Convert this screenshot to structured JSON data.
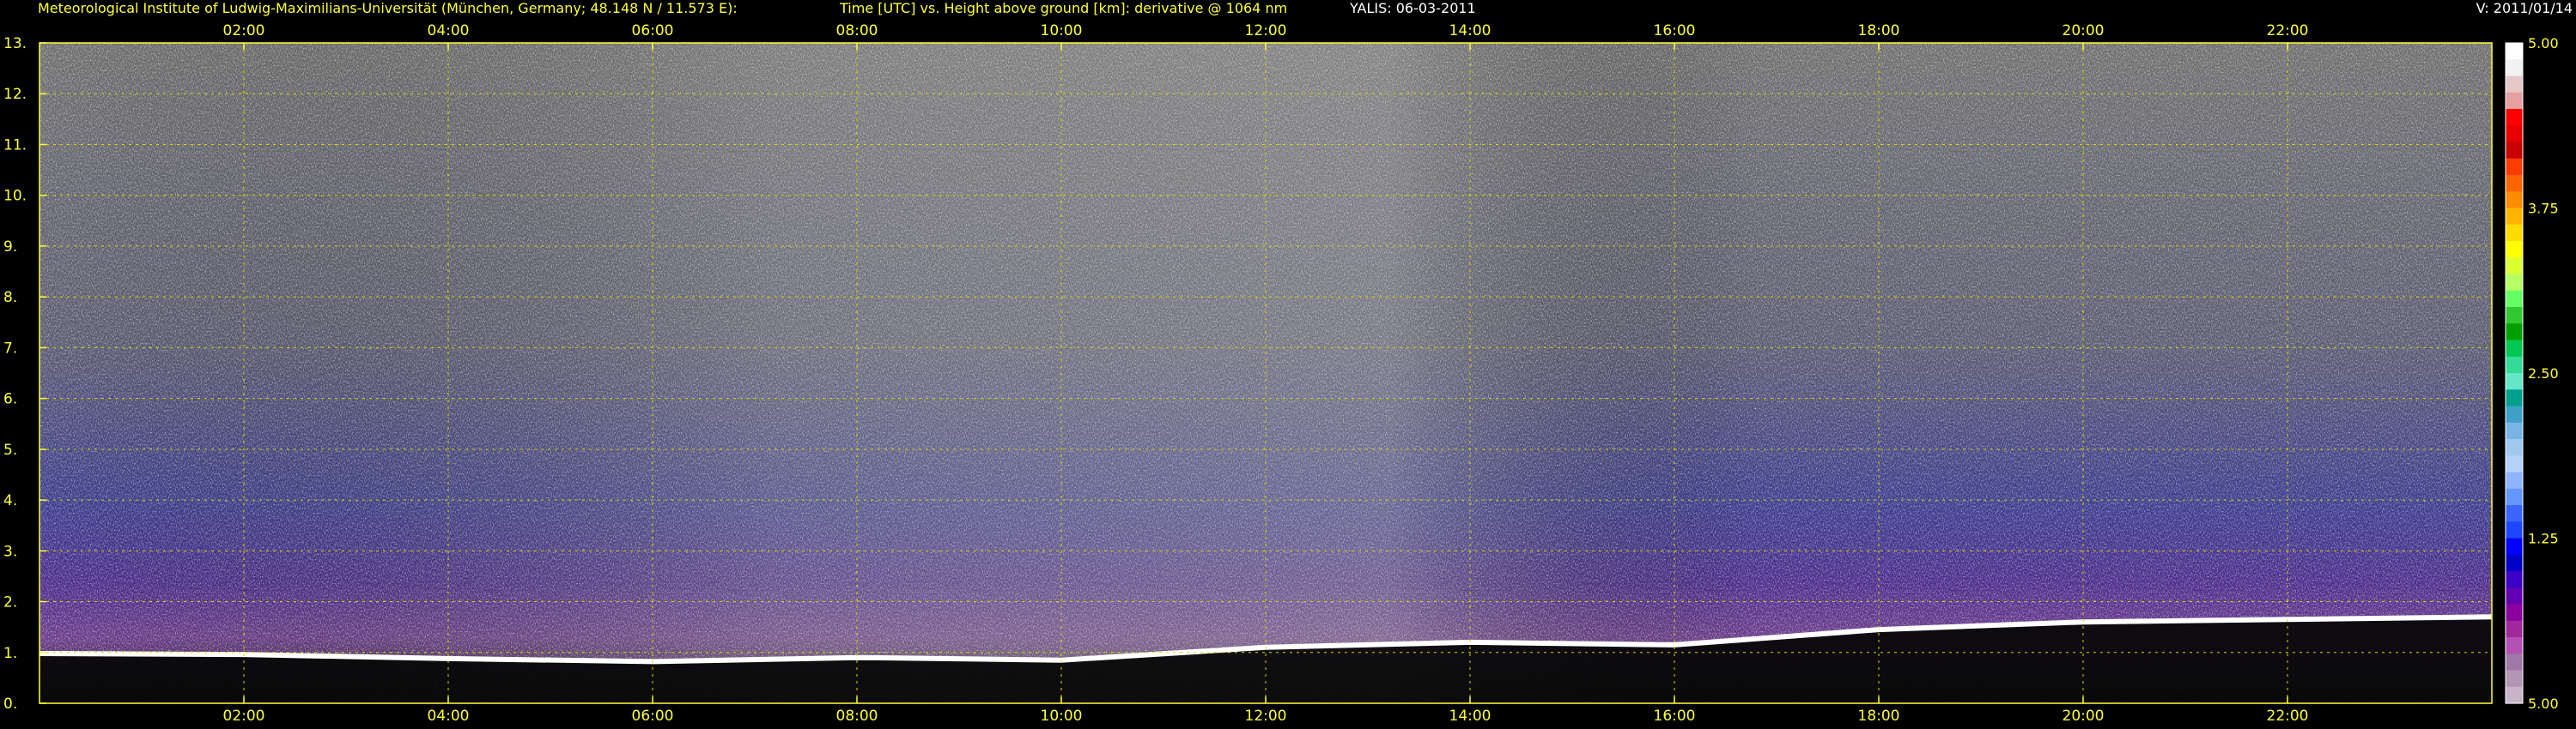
{
  "header": {
    "institute": "Meteorological Institute of Ludwig-Maximilians-Universität (München, Germany; 48.148 N / 11.573 E):",
    "title": "Time [UTC] vs. Height above ground [km]: derivative @ 1064 nm",
    "instrument_date": "YALIS: 06-03-2011",
    "version": "V: 2011/01/14"
  },
  "colors": {
    "text_yellow": "#ffff33",
    "text_white": "#ffffff",
    "grid": "#d8d800",
    "background": "#000000"
  },
  "chart_data": {
    "type": "heatmap",
    "title": "Time [UTC] vs. Height above ground [km]: derivative @ 1064 nm",
    "xlabel": "Time [UTC]",
    "ylabel": "Height above ground [km]",
    "x_range_hours": [
      0,
      24
    ],
    "x_ticks": [
      {
        "hour": 2,
        "label": "02:00"
      },
      {
        "hour": 4,
        "label": "04:00"
      },
      {
        "hour": 6,
        "label": "06:00"
      },
      {
        "hour": 8,
        "label": "08:00"
      },
      {
        "hour": 10,
        "label": "10:00"
      },
      {
        "hour": 12,
        "label": "12:00"
      },
      {
        "hour": 14,
        "label": "14:00"
      },
      {
        "hour": 16,
        "label": "16:00"
      },
      {
        "hour": 18,
        "label": "18:00"
      },
      {
        "hour": 20,
        "label": "20:00"
      },
      {
        "hour": 22,
        "label": "22:00"
      }
    ],
    "ylim": [
      0,
      13
    ],
    "y_ticks": [
      {
        "value": 0,
        "label": "0."
      },
      {
        "value": 1,
        "label": "1."
      },
      {
        "value": 2,
        "label": "2."
      },
      {
        "value": 3,
        "label": "3."
      },
      {
        "value": 4,
        "label": "4."
      },
      {
        "value": 5,
        "label": "5."
      },
      {
        "value": 6,
        "label": "6."
      },
      {
        "value": 7,
        "label": "7."
      },
      {
        "value": 8,
        "label": "8."
      },
      {
        "value": 9,
        "label": "9."
      },
      {
        "value": 10,
        "label": "10."
      },
      {
        "value": 11,
        "label": "11."
      },
      {
        "value": 12,
        "label": "12."
      },
      {
        "value": 13,
        "label": "13."
      }
    ],
    "grid": true,
    "colorbar": {
      "labels": [
        {
          "value": 5.0,
          "label": "5.00"
        },
        {
          "value": 3.75,
          "label": "3.75"
        },
        {
          "value": 2.5,
          "label": "2.50"
        },
        {
          "value": 1.25,
          "label": "1.25"
        },
        {
          "value": 0,
          "label": "5.00"
        }
      ],
      "colors_top_to_bottom": [
        "#ffffff",
        "#f2f2f2",
        "#e6c8c8",
        "#e6a0a0",
        "#ff0000",
        "#e60000",
        "#c80000",
        "#ff3c00",
        "#ff6400",
        "#ff8c00",
        "#ffb400",
        "#ffdc00",
        "#ffff00",
        "#dcff32",
        "#b4ff64",
        "#64ff64",
        "#32c832",
        "#00a000",
        "#00c850",
        "#32dc96",
        "#64e6c8",
        "#00a08c",
        "#3ca0c8",
        "#78b4e6",
        "#a0c8f0",
        "#b4d2fa",
        "#8cb4ff",
        "#6496ff",
        "#3c64ff",
        "#1e46ff",
        "#0000ff",
        "#0000c8",
        "#3c00c8",
        "#6400b4",
        "#8c00a0",
        "#a0289c",
        "#b450b4",
        "#a078a8",
        "#b496b4",
        "#c8b4c8"
      ]
    },
    "cloud_base_km": [
      {
        "hour": 0.0,
        "km": 0.98
      },
      {
        "hour": 2.0,
        "km": 0.96
      },
      {
        "hour": 4.0,
        "km": 0.88
      },
      {
        "hour": 6.0,
        "km": 0.82
      },
      {
        "hour": 8.0,
        "km": 0.9
      },
      {
        "hour": 10.0,
        "km": 0.85
      },
      {
        "hour": 12.0,
        "km": 1.1
      },
      {
        "hour": 14.0,
        "km": 1.2
      },
      {
        "hour": 16.0,
        "km": 1.15
      },
      {
        "hour": 18.0,
        "km": 1.45
      },
      {
        "hour": 20.0,
        "km": 1.6
      },
      {
        "hour": 22.0,
        "km": 1.65
      },
      {
        "hour": 24.0,
        "km": 1.7
      }
    ]
  }
}
